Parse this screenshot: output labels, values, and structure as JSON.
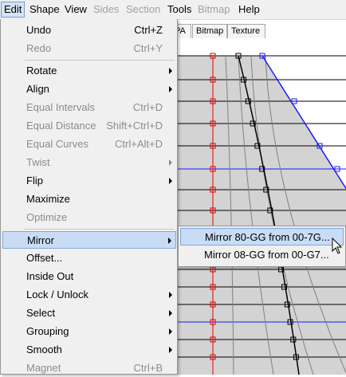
{
  "menubar": {
    "items": [
      {
        "label": "Edit",
        "state": "active"
      },
      {
        "label": "Shape",
        "state": "normal"
      },
      {
        "label": "View",
        "state": "normal"
      },
      {
        "label": "Sides",
        "state": "disabled"
      },
      {
        "label": "Section",
        "state": "disabled"
      },
      {
        "label": "Tools",
        "state": "normal"
      },
      {
        "label": "Bitmap",
        "state": "disabled"
      },
      {
        "label": "Help",
        "state": "normal"
      }
    ]
  },
  "tabs": [
    "PA",
    "Bitmap",
    "Texture"
  ],
  "edit_menu": {
    "items": [
      {
        "label": "Undo",
        "shortcut": "Ctrl+Z",
        "disabled": false,
        "submenu": false
      },
      {
        "label": "Redo",
        "shortcut": "Ctrl+Y",
        "disabled": true,
        "submenu": false
      },
      {
        "label": "Rotate",
        "shortcut": "",
        "disabled": false,
        "submenu": true
      },
      {
        "label": "Align",
        "shortcut": "",
        "disabled": false,
        "submenu": true
      },
      {
        "label": "Equal Intervals",
        "shortcut": "Ctrl+D",
        "disabled": true,
        "submenu": false
      },
      {
        "label": "Equal Distance",
        "shortcut": "Shift+Ctrl+D",
        "disabled": true,
        "submenu": false
      },
      {
        "label": "Equal Curves",
        "shortcut": "Ctrl+Alt+D",
        "disabled": true,
        "submenu": false
      },
      {
        "label": "Twist",
        "shortcut": "",
        "disabled": true,
        "submenu": true
      },
      {
        "label": "Flip",
        "shortcut": "",
        "disabled": false,
        "submenu": true
      },
      {
        "label": "Maximize",
        "shortcut": "",
        "disabled": false,
        "submenu": false
      },
      {
        "label": "Optimize",
        "shortcut": "",
        "disabled": true,
        "submenu": false
      },
      {
        "label": "Mirror",
        "shortcut": "",
        "disabled": false,
        "submenu": true,
        "highlighted": true
      },
      {
        "label": "Offset...",
        "shortcut": "",
        "disabled": false,
        "submenu": false
      },
      {
        "label": "Inside Out",
        "shortcut": "",
        "disabled": false,
        "submenu": false
      },
      {
        "label": "Lock / Unlock",
        "shortcut": "",
        "disabled": false,
        "submenu": true
      },
      {
        "label": "Select",
        "shortcut": "",
        "disabled": false,
        "submenu": true
      },
      {
        "label": "Grouping",
        "shortcut": "",
        "disabled": false,
        "submenu": true
      },
      {
        "label": "Smooth",
        "shortcut": "",
        "disabled": false,
        "submenu": true
      },
      {
        "label": "Magnet",
        "shortcut": "Ctrl+B",
        "disabled": true,
        "submenu": false
      }
    ]
  },
  "mirror_submenu": {
    "items": [
      {
        "label": "Mirror 80-GG from 00-7G...",
        "highlighted": true
      },
      {
        "label": "Mirror 08-GG from 00-G7...",
        "highlighted": false
      }
    ]
  },
  "colors": {
    "menu_bg": "#f0f0f0",
    "highlight": "#c9dcf5",
    "red_curve": "#e00000",
    "blue_curve": "#1a1aff",
    "dark_curve": "#000000",
    "gray_curve": "#808080",
    "gray_fill": "#d3d3d3"
  }
}
